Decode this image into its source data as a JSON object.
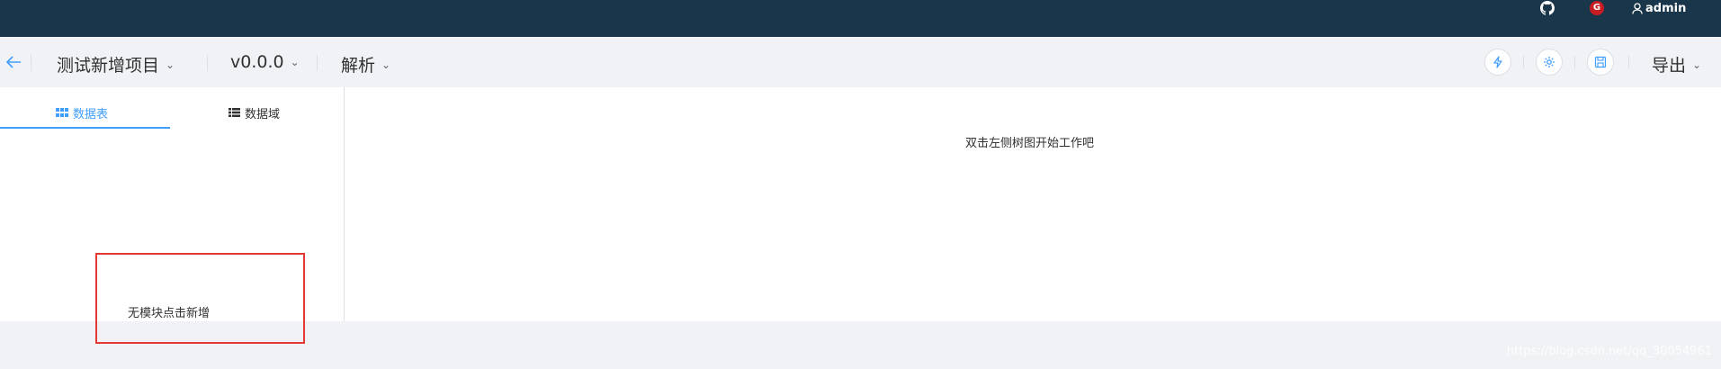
{
  "topbar": {
    "github_icon": "github-icon",
    "gitee_icon": "gitee-icon",
    "gitee_letter": "G",
    "user_icon": "user-icon",
    "username": "admin"
  },
  "toolbar": {
    "back_icon": "arrow-left-icon",
    "project": "测试新增项目",
    "version": "v0.0.0",
    "view": "解析",
    "caret": "⌄",
    "actions": [
      "lightning-icon",
      "gear-icon",
      "save-icon"
    ],
    "export": "导出"
  },
  "left_panel": {
    "tabs": [
      {
        "label": "数据表",
        "icon": "grid-icon",
        "active": true
      },
      {
        "label": "数据域",
        "icon": "list-icon",
        "active": false
      }
    ],
    "empty_text": "无模块点击新增"
  },
  "main_panel": {
    "empty_text": "双击左侧树图开始工作吧"
  },
  "watermark": "https://blog.csdn.net/qq_30054961",
  "colors": {
    "topbar": "#19364b",
    "accent": "#409eff",
    "annotation": "#e53935"
  }
}
